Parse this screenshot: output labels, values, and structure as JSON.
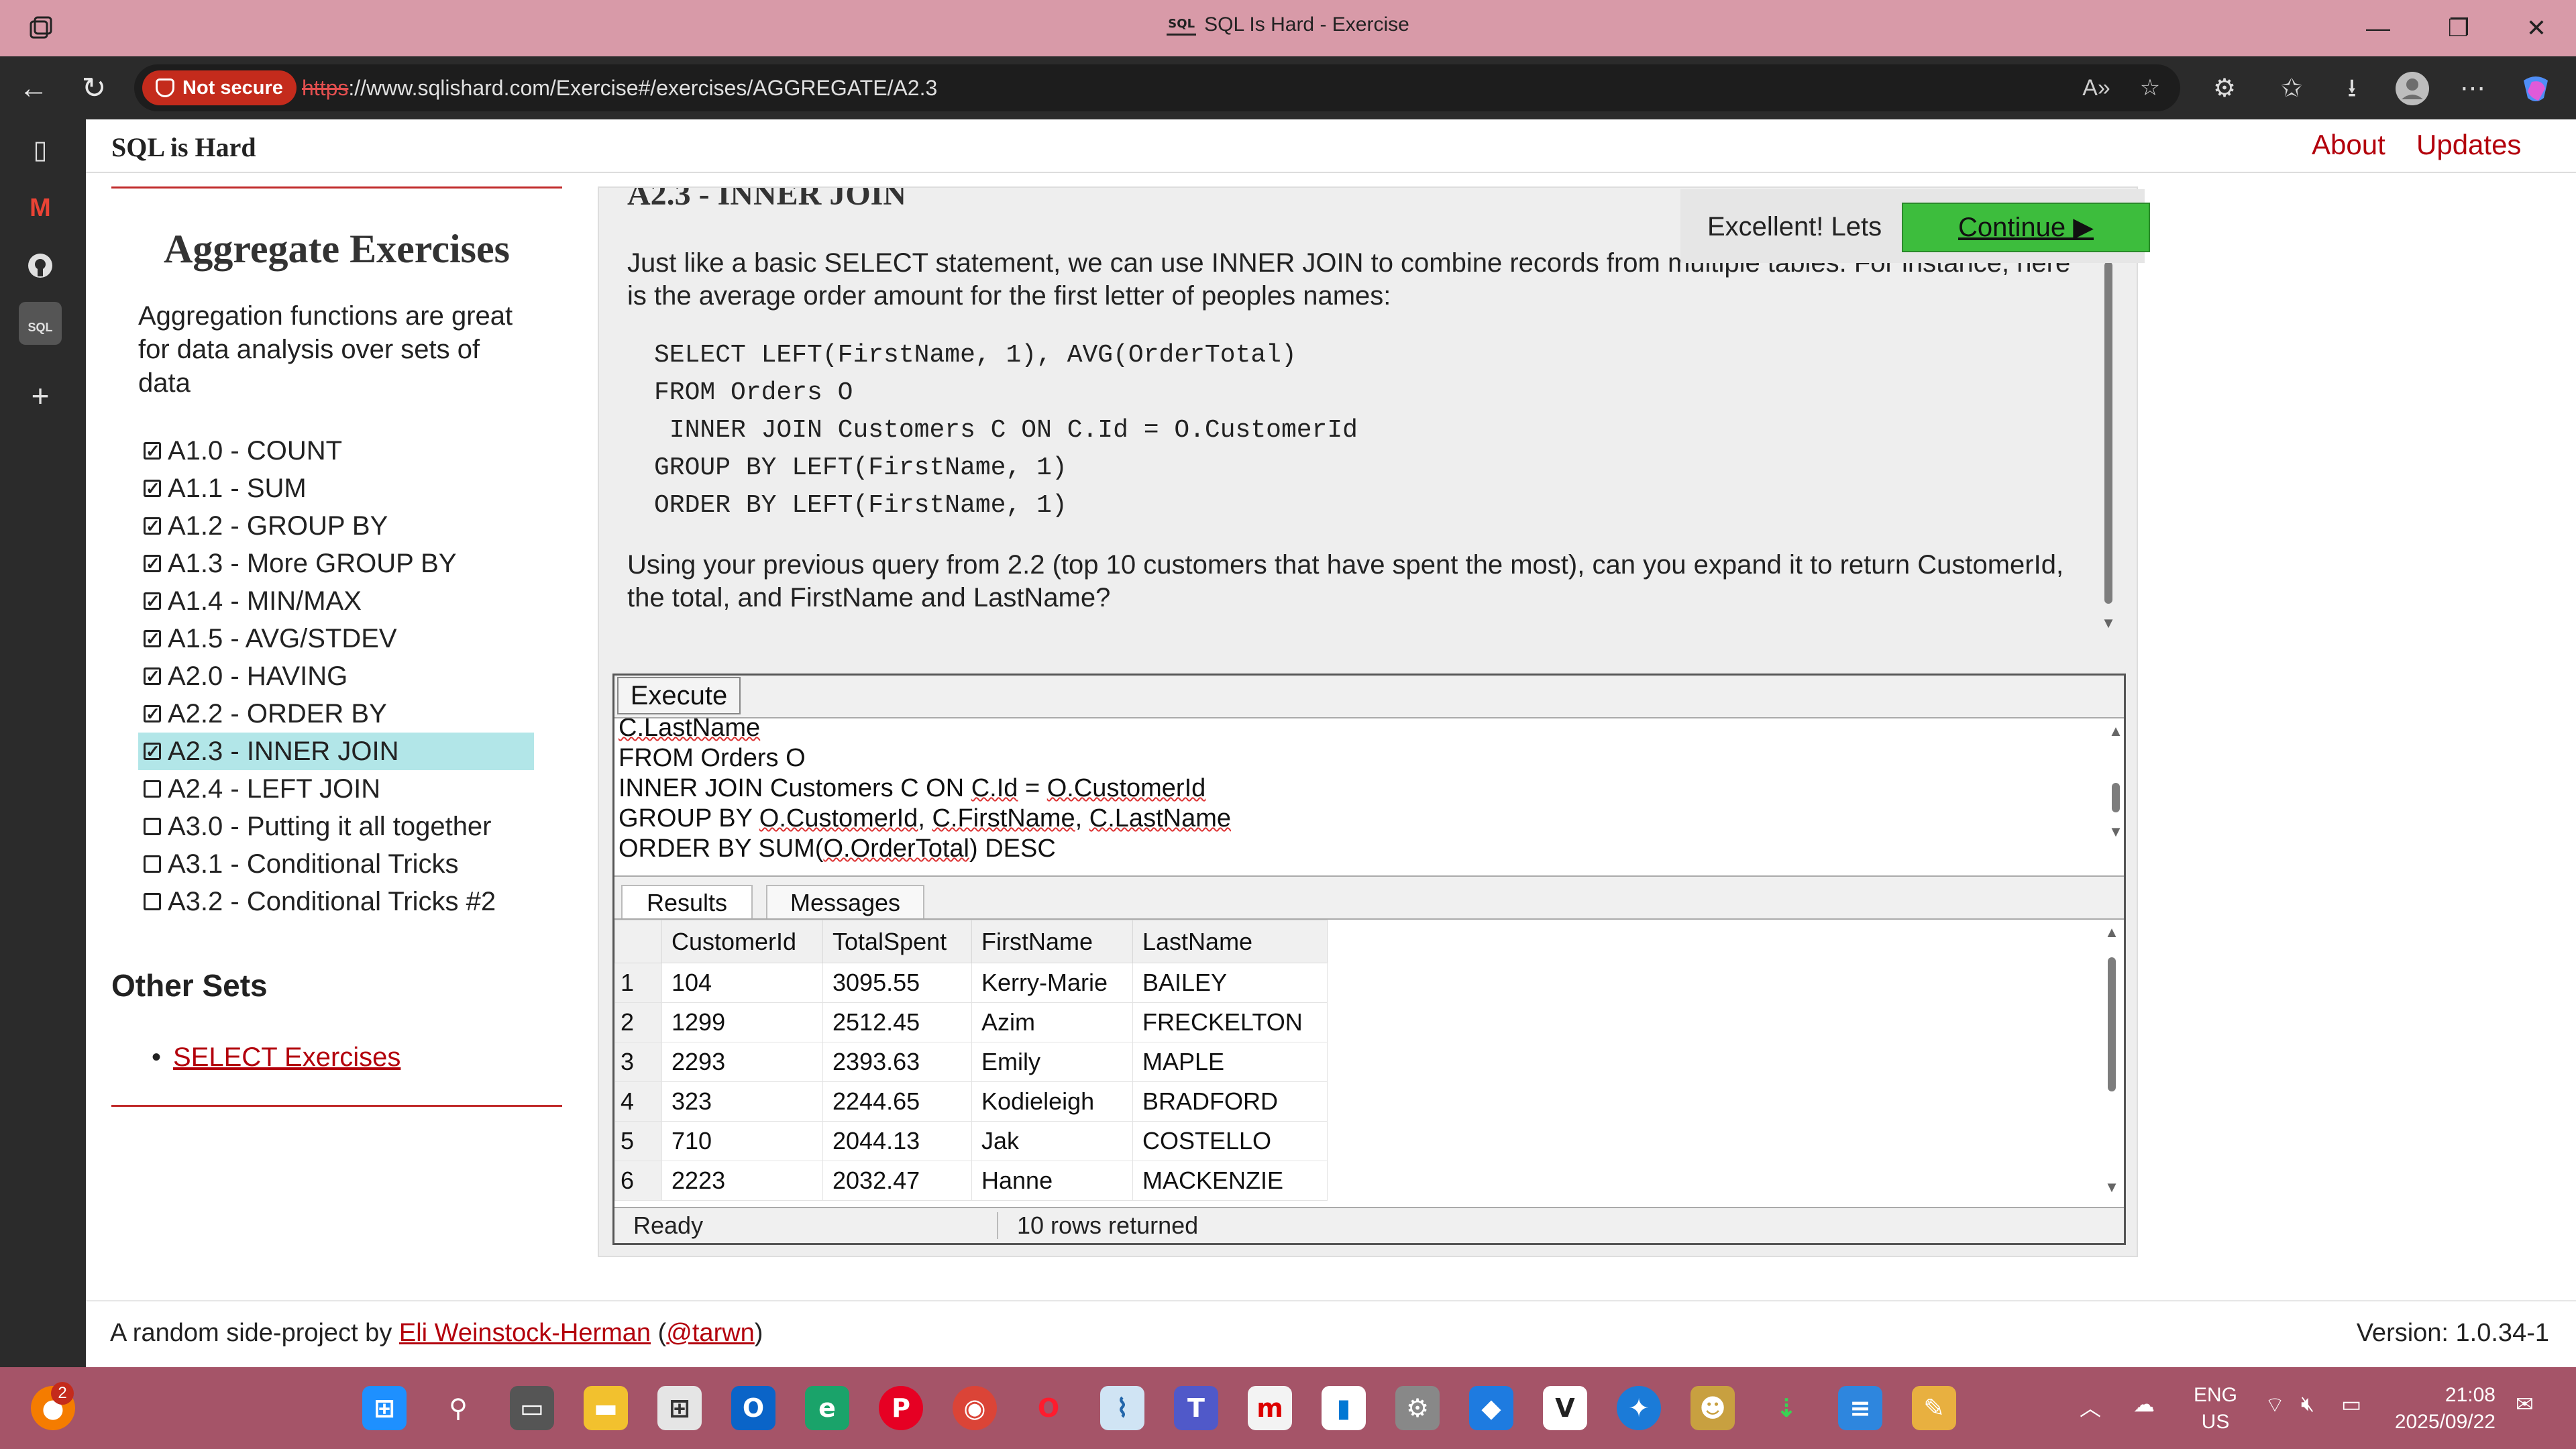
{
  "window": {
    "title": "SQL Is Hard - Exercise",
    "favicon_text": "SQL"
  },
  "addressbar": {
    "security_label": "Not secure",
    "url_scheme": "https",
    "url_rest": "://www.sqlishard.com/Exercise#/exercises/AGGREGATE/A2.3"
  },
  "site": {
    "brand": "SQL is Hard",
    "nav": [
      "About",
      "Updates"
    ]
  },
  "sidebar": {
    "heading": "Aggregate Exercises",
    "intro": "Aggregation functions are great for data analysis over sets of data",
    "exercises": [
      {
        "label": "A1.0 - COUNT",
        "done": true
      },
      {
        "label": "A1.1 - SUM",
        "done": true
      },
      {
        "label": "A1.2 - GROUP BY",
        "done": true
      },
      {
        "label": "A1.3 - More GROUP BY",
        "done": true
      },
      {
        "label": "A1.4 - MIN/MAX",
        "done": true
      },
      {
        "label": "A1.5 - AVG/STDEV",
        "done": true
      },
      {
        "label": "A2.0 - HAVING",
        "done": true
      },
      {
        "label": "A2.2 - ORDER BY",
        "done": true
      },
      {
        "label": "A2.3 - INNER JOIN",
        "done": true,
        "active": true
      },
      {
        "label": "A2.4 - LEFT JOIN",
        "done": false
      },
      {
        "label": "A3.0 - Putting it all together",
        "done": false
      },
      {
        "label": "A3.1 - Conditional Tricks",
        "done": false
      },
      {
        "label": "A3.2 - Conditional Tricks #2",
        "done": false
      }
    ],
    "other_sets_heading": "Other Sets",
    "other_sets": [
      "SELECT Exercises"
    ]
  },
  "exercise": {
    "title": "A2.3 - INNER JOIN",
    "description": "Just like a basic SELECT statement, we can use INNER JOIN to combine records from multiple tables. For instance, here is the average order amount for the first letter of peoples names:",
    "code": "SELECT LEFT(FirstName, 1), AVG(OrderTotal)\nFROM Orders O\n INNER JOIN Customers C ON C.Id = O.CustomerId\nGROUP BY LEFT(FirstName, 1)\nORDER BY LEFT(FirstName, 1)",
    "question": "Using your previous query from 2.2 (top 10 customers that have spent the most), can you expand it to return CustomerId, the total, and FirstName and LastName?"
  },
  "toast": {
    "message": "Excellent! Lets",
    "button": "Continue ▶"
  },
  "editor": {
    "execute_label": "Execute",
    "lines": [
      "C.LastName",
      "FROM Orders O",
      "INNER JOIN Customers C ON C.Id = O.CustomerId",
      "GROUP BY O.CustomerId, C.FirstName, C.LastName",
      "ORDER BY SUM(O.OrderTotal) DESC"
    ]
  },
  "results": {
    "tabs": [
      "Results",
      "Messages"
    ],
    "columns": [
      "CustomerId",
      "TotalSpent",
      "FirstName",
      "LastName"
    ],
    "rows": [
      [
        "1",
        "104",
        "3095.55",
        "Kerry-Marie",
        "BAILEY"
      ],
      [
        "2",
        "1299",
        "2512.45",
        "Azim",
        "FRECKELTON"
      ],
      [
        "3",
        "2293",
        "2393.63",
        "Emily",
        "MAPLE"
      ],
      [
        "4",
        "323",
        "2244.65",
        "Kodieleigh",
        "BRADFORD"
      ],
      [
        "5",
        "710",
        "2044.13",
        "Jak",
        "COSTELLO"
      ],
      [
        "6",
        "2223",
        "2032.47",
        "Hanne",
        "MACKENZIE"
      ]
    ],
    "status": "Ready",
    "row_count": "10 rows returned"
  },
  "footer": {
    "prefix": "A random side-project by ",
    "author": "Eli Weinstock-Herman",
    "handle_open": " (",
    "handle": "@tarwn",
    "handle_close": ")",
    "version": "Version: 1.0.34-1"
  },
  "taskbar": {
    "notification_count": "2",
    "language": "ENG",
    "region": "US",
    "time": "21:08",
    "date": "2025/09/22"
  },
  "colors": {
    "titlebar": "#d89aa8",
    "taskbar": "#a55468",
    "link_red": "#b3000c",
    "active_item": "#b2e6e8",
    "continue_green": "#3dbd3d"
  }
}
